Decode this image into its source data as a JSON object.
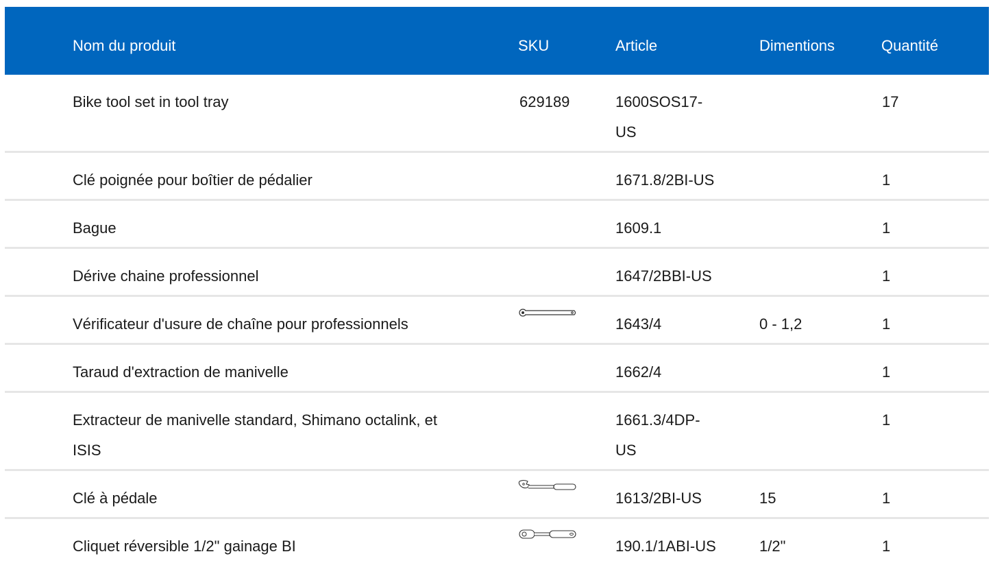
{
  "columns": {
    "name": "Nom du produit",
    "sku": "SKU",
    "article": "Article",
    "dimensions": "Dimentions",
    "quantity": "Quantité"
  },
  "rows": [
    {
      "name": "Bike tool set in tool tray",
      "sku": "629189",
      "article": "1600SOS17-US",
      "dimensions": "",
      "quantity": "17",
      "icon": ""
    },
    {
      "name": "Clé poignée pour boîtier de pédalier",
      "sku": "",
      "article": "1671.8/2BI-US",
      "dimensions": "",
      "quantity": "1",
      "icon": ""
    },
    {
      "name": "Bague",
      "sku": "",
      "article": "1609.1",
      "dimensions": "",
      "quantity": "1",
      "icon": ""
    },
    {
      "name": "Dérive chaine professionnel",
      "sku": "",
      "article": "1647/2BBI-US",
      "dimensions": "",
      "quantity": "1",
      "icon": ""
    },
    {
      "name": "Vérificateur d'usure de chaîne pour professionnels",
      "sku": "",
      "article": "1643/4",
      "dimensions": "0 - 1,2",
      "quantity": "1",
      "icon": "chain-wear-gauge-icon"
    },
    {
      "name": "Taraud d'extraction de manivelle",
      "sku": "",
      "article": "1662/4",
      "dimensions": "",
      "quantity": "1",
      "icon": ""
    },
    {
      "name": "Extracteur de manivelle standard, Shimano octalink, et ISIS",
      "sku": "",
      "article": "1661.3/4DP-US",
      "dimensions": "",
      "quantity": "1",
      "icon": ""
    },
    {
      "name": "Clé à pédale",
      "sku": "",
      "article": "1613/2BI-US",
      "dimensions": "15",
      "quantity": "1",
      "icon": "pedal-wrench-icon"
    },
    {
      "name": "Cliquet réversible 1/2\" gainage BI",
      "sku": "",
      "article": "190.1/1ABI-US",
      "dimensions": "1/2\"",
      "quantity": "1",
      "icon": "ratchet-icon"
    }
  ]
}
